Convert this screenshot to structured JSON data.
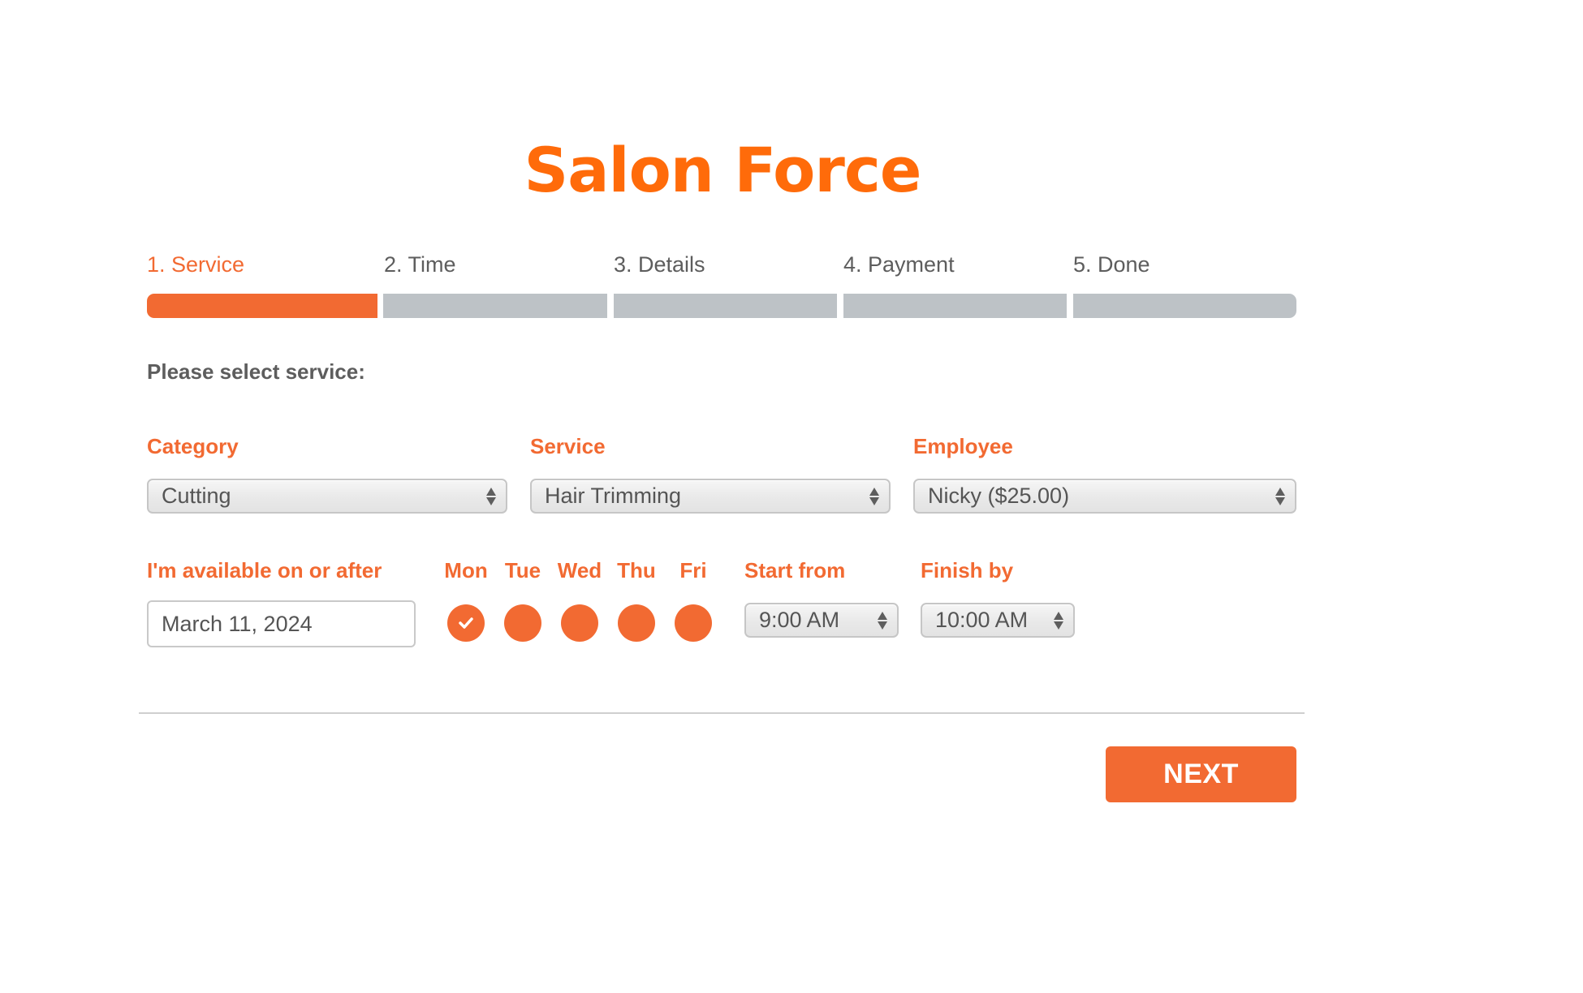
{
  "app": {
    "title": "Salon Force",
    "accent_color": "#f26a32",
    "title_color": "#ff6b0a"
  },
  "steps": [
    {
      "label": "1. Service",
      "active": true
    },
    {
      "label": "2. Time",
      "active": false
    },
    {
      "label": "3. Details",
      "active": false
    },
    {
      "label": "4. Payment",
      "active": false
    },
    {
      "label": "5. Done",
      "active": false
    }
  ],
  "progress": {
    "current_step": 1,
    "total_steps": 5
  },
  "prompt": "Please select service:",
  "fields": {
    "category": {
      "label": "Category",
      "value": "Cutting"
    },
    "service": {
      "label": "Service",
      "value": "Hair Trimming"
    },
    "employee": {
      "label": "Employee",
      "value": "Nicky ($25.00)"
    }
  },
  "availability": {
    "label": "I'm available on or after",
    "date_value": "March 11, 2024",
    "days": [
      {
        "label": "Mon",
        "checked": true
      },
      {
        "label": "Tue",
        "checked": false
      },
      {
        "label": "Wed",
        "checked": false
      },
      {
        "label": "Thu",
        "checked": false
      },
      {
        "label": "Fri",
        "checked": false
      }
    ],
    "start": {
      "label": "Start from",
      "value": "9:00 AM"
    },
    "finish": {
      "label": "Finish by",
      "value": "10:00 AM"
    }
  },
  "actions": {
    "next_label": "NEXT"
  }
}
